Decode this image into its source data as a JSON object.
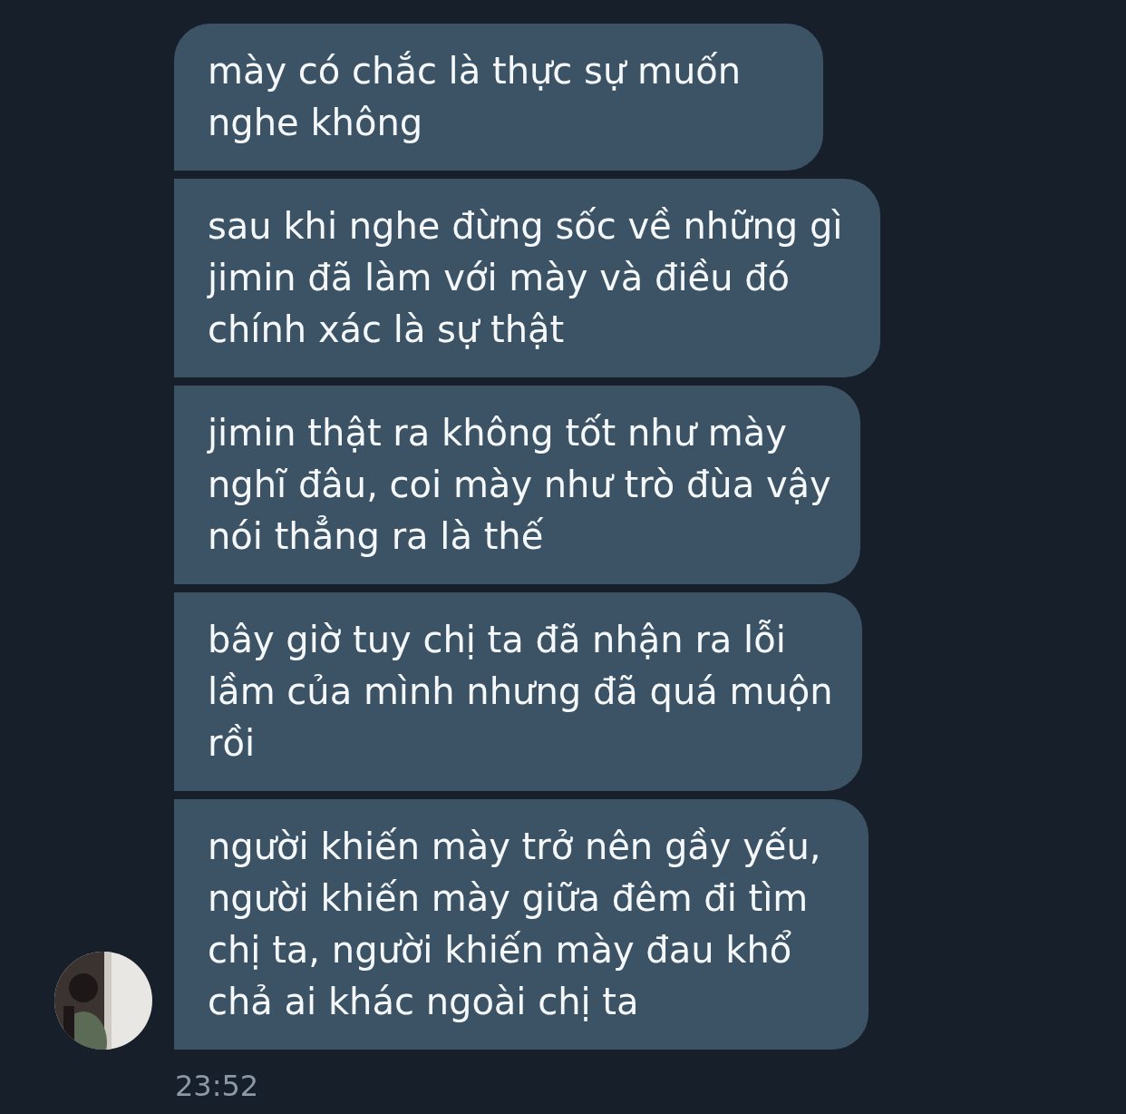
{
  "messages": [
    {
      "text": "mày có chắc là thực sự muốn nghe không"
    },
    {
      "text": "sau khi nghe đừng sốc về những gì jimin đã làm với mày và điều đó chính xác là sự thật"
    },
    {
      "text": "jimin thật ra không tốt như mày nghĩ đâu, coi mày như trò đùa vậy nói thẳng ra là thế"
    },
    {
      "text": "bây giờ tuy chị ta đã nhận ra lỗi lầm của mình nhưng đã quá muộn rồi"
    },
    {
      "text": "người khiến mày trở nên gầy yếu, người khiến mày giữa đêm đi tìm chị ta, người khiến mày đau khổ chả ai khác ngoài chị ta"
    }
  ],
  "timestamp": "23:52"
}
